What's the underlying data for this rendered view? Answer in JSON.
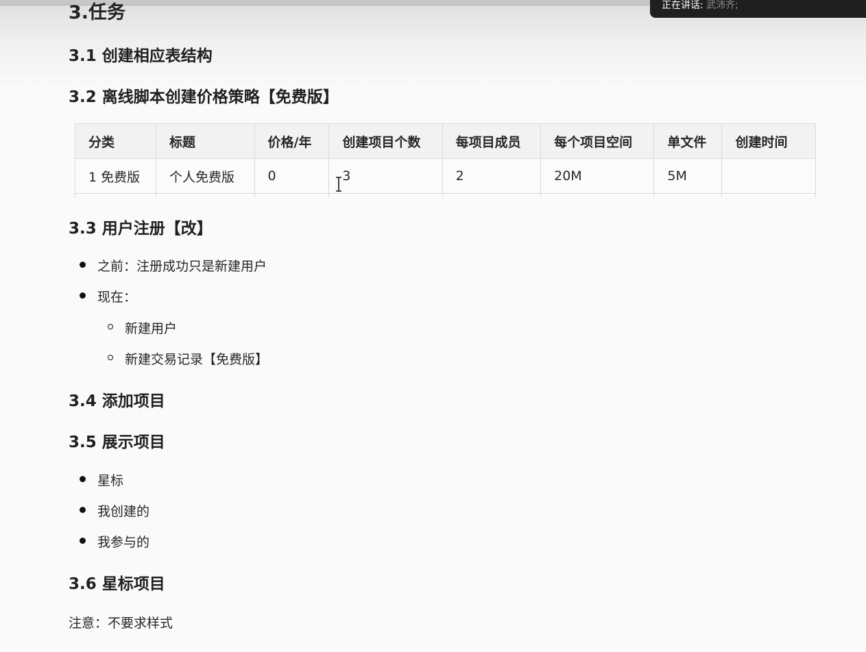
{
  "overlay": {
    "label": "正在讲话:",
    "speaker": "武沛齐;"
  },
  "sections": {
    "tasks_title": "3.任务",
    "s31_title": "3.1 创建相应表结构",
    "s32_title": "3.2 离线脚本创建价格策略【免费版】",
    "s33_title": "3.3 用户注册【改】",
    "s34_title": "3.4 添加项目",
    "s35_title": "3.5 展示项目",
    "s36_title": "3.6 星标项目"
  },
  "price_table": {
    "headers": [
      "分类",
      "标题",
      "价格/年",
      "创建项目个数",
      "每项目成员",
      "每个项目空间",
      "单文件",
      "创建时间"
    ],
    "rows": [
      [
        "1 免费版",
        "个人免费版",
        "0",
        "3",
        "2",
        "20M",
        "5M",
        ""
      ]
    ]
  },
  "s33_list": {
    "items": [
      {
        "text": "之前：注册成功只是新建用户"
      },
      {
        "text": "现在："
      }
    ],
    "sub_items": [
      {
        "text": "新建用户"
      },
      {
        "text": "新建交易记录【免费版】"
      }
    ]
  },
  "s35_list": {
    "items": [
      {
        "text": "星标"
      },
      {
        "text": "我创建的"
      },
      {
        "text": "我参与的"
      }
    ]
  },
  "note": "注意：不要求样式",
  "icons": {
    "cursor": "text-cursor-icon"
  }
}
